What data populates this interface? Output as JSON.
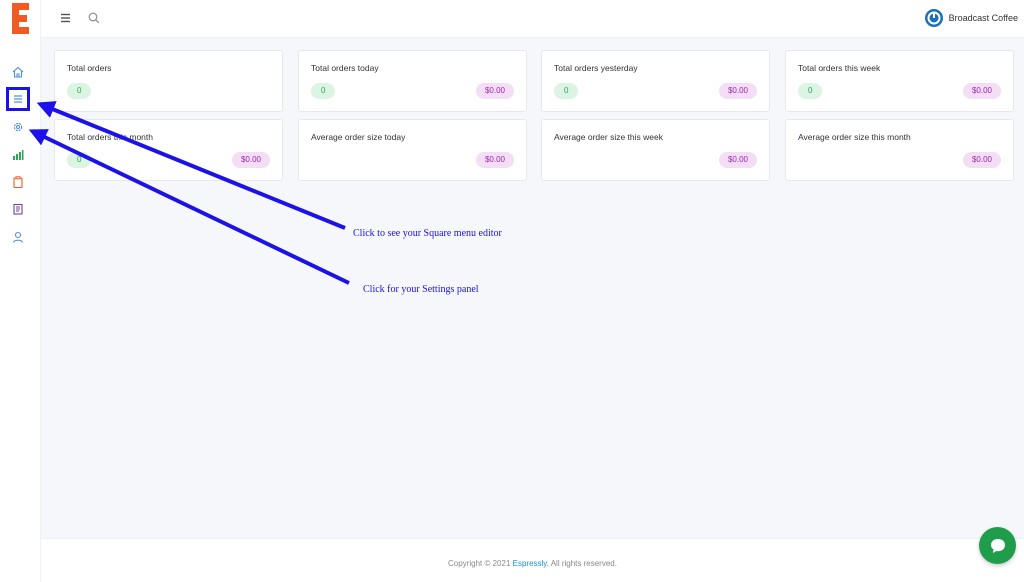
{
  "brand": {
    "logo_letter": "E",
    "logo_color": "#f15a24",
    "business_name": "Broadcast Coffee",
    "business_logo_color": "#1d6fb8"
  },
  "sidebar": {
    "items": [
      {
        "name": "home",
        "icon": "home-icon",
        "color": "#4a90d9"
      },
      {
        "name": "menu",
        "icon": "list-icon",
        "color": "#4a90d9"
      },
      {
        "name": "settings",
        "icon": "gear-icon",
        "color": "#4a90d9"
      },
      {
        "name": "reports",
        "icon": "bar-chart-icon",
        "color": "#2aa753"
      },
      {
        "name": "orders",
        "icon": "clipboard-icon",
        "color": "#f15a24"
      },
      {
        "name": "catalog",
        "icon": "book-icon",
        "color": "#7b3fa0"
      },
      {
        "name": "account",
        "icon": "user-icon",
        "color": "#4a90d9"
      }
    ]
  },
  "topbar": {
    "menu_icon": "hamburger-icon",
    "search_icon": "search-icon"
  },
  "cards": [
    {
      "title": "Total orders",
      "count": "0",
      "amount": ""
    },
    {
      "title": "Total orders today",
      "count": "0",
      "amount": "$0.00"
    },
    {
      "title": "Total orders yesterday",
      "count": "0",
      "amount": "$0.00"
    },
    {
      "title": "Total orders this week",
      "count": "0",
      "amount": "$0.00"
    },
    {
      "title": "Total orders this month",
      "count": "0",
      "amount": "$0.00"
    },
    {
      "title": "Average order size today",
      "count": "",
      "amount": "$0.00"
    },
    {
      "title": "Average order size this week",
      "count": "",
      "amount": "$0.00"
    },
    {
      "title": "Average order size this month",
      "count": "",
      "amount": "$0.00"
    }
  ],
  "annotations": {
    "menu_editor": "Click to see your Square menu editor",
    "settings": "Click for your Settings panel",
    "color": "#1a12e8"
  },
  "footer": {
    "prefix": "Copyright © 2021 ",
    "link": "Espressly",
    "suffix": ". All rights reserved."
  },
  "chat": {
    "icon": "chat-bubble-icon",
    "color": "#1f9d4a"
  }
}
